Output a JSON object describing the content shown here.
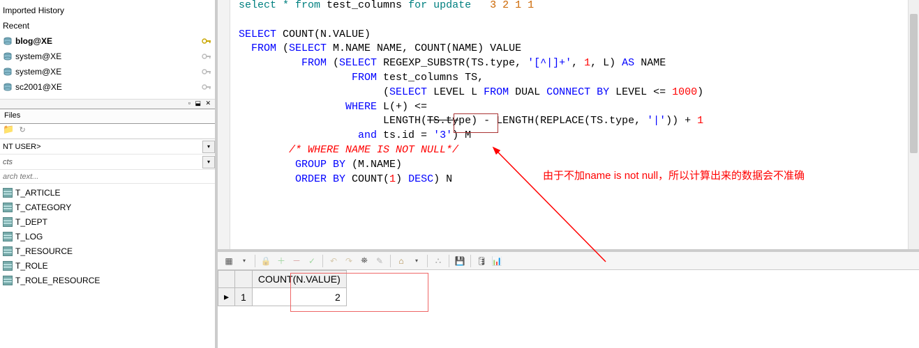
{
  "history": {
    "title": "Imported History",
    "recent_label": "Recent",
    "connections": [
      {
        "label": "blog@XE",
        "bold": true,
        "key_color": "#c9a600"
      },
      {
        "label": "system@XE",
        "bold": false,
        "key_color": "#bbb"
      },
      {
        "label": "system@XE",
        "bold": false,
        "key_color": "#bbb"
      },
      {
        "label": "sc2001@XE",
        "bold": false,
        "key_color": "#bbb"
      }
    ]
  },
  "dock_controls": "▫ ⬓ ✕",
  "files_panel": {
    "title": "Files",
    "user_value": "NT USER>",
    "filter_value": "cts",
    "search_placeholder": "arch text..."
  },
  "tables": [
    "T_ARTICLE",
    "T_CATEGORY",
    "T_DEPT",
    "T_LOG",
    "T_RESOURCE",
    "T_ROLE",
    "T_ROLE_RESOURCE"
  ],
  "sql": {
    "line1_pre": "select * from ",
    "line1_tbl": "test_columns",
    "line1_mid": " for update",
    "line1_tail": "   3 2 1 1",
    "l3_a": "SELECT",
    "l3_b": " COUNT(N.VALUE)",
    "l4_a": "  FROM",
    "l4_b": " (",
    "l4_c": "SELECT",
    "l4_d": " M.NAME NAME, COUNT(NAME) VALUE",
    "l5_a": "          FROM",
    "l5_b": " (",
    "l5_c": "SELECT",
    "l5_d": " REGEXP_SUBSTR(TS.type, ",
    "l5_e": "'[^|]+'",
    "l5_f": ", ",
    "l5_g": "1",
    "l5_h": ", L) ",
    "l5_i": "AS",
    "l5_j": " NAME",
    "l6_a": "                  FROM",
    "l6_b": " test_columns TS,",
    "l7_a": "                       (",
    "l7_b": "SELECT",
    "l7_c": " LEVEL L ",
    "l7_d": "FROM",
    "l7_e": " DUAL ",
    "l7_f": "CONNECT BY",
    "l7_g": " LEVEL <= ",
    "l7_h": "1000",
    "l7_i": ")",
    "l8_a": "                 WHERE",
    "l8_b": " L(+) <=",
    "l9_a": "                       LENGTH(",
    "l9_b": "TS.ty",
    "l9_c": "pe) - LENGTH(REPLACE(TS.type, ",
    "l9_d": "'|'",
    "l9_e": ")) + ",
    "l9_f": "1",
    "l10_a": "                   and",
    "l10_b": " ts.id = ",
    "l10_c": "'3'",
    "l10_d": ") M",
    "l11": "        /* WHERE NAME IS NOT NULL*/",
    "l12_a": "         GROUP BY",
    "l12_b": " (M.NAME)",
    "l13_a": "         ORDER BY",
    "l13_b": " COUNT(",
    "l13_c": "1",
    "l13_d": ") ",
    "l13_e": "DESC",
    "l13_f": ") N"
  },
  "annotation_text": "由于不加name is not null，所以计算出来的数据会不准确",
  "result": {
    "column_header": "COUNT(N.VALUE)",
    "row_num": "1",
    "value": "2",
    "row_marker": "▸"
  },
  "toolbar_icons": {
    "grid": "▦",
    "lock": "🔒",
    "plus": "＋",
    "minus": "－",
    "check": "✓",
    "undo": "↶",
    "find": "⛯",
    "eraser": "✎",
    "home": "⌂",
    "dd": "▾",
    "funnel": "⛬",
    "save": "💾",
    "db": "🛢",
    "chart": "📊"
  }
}
